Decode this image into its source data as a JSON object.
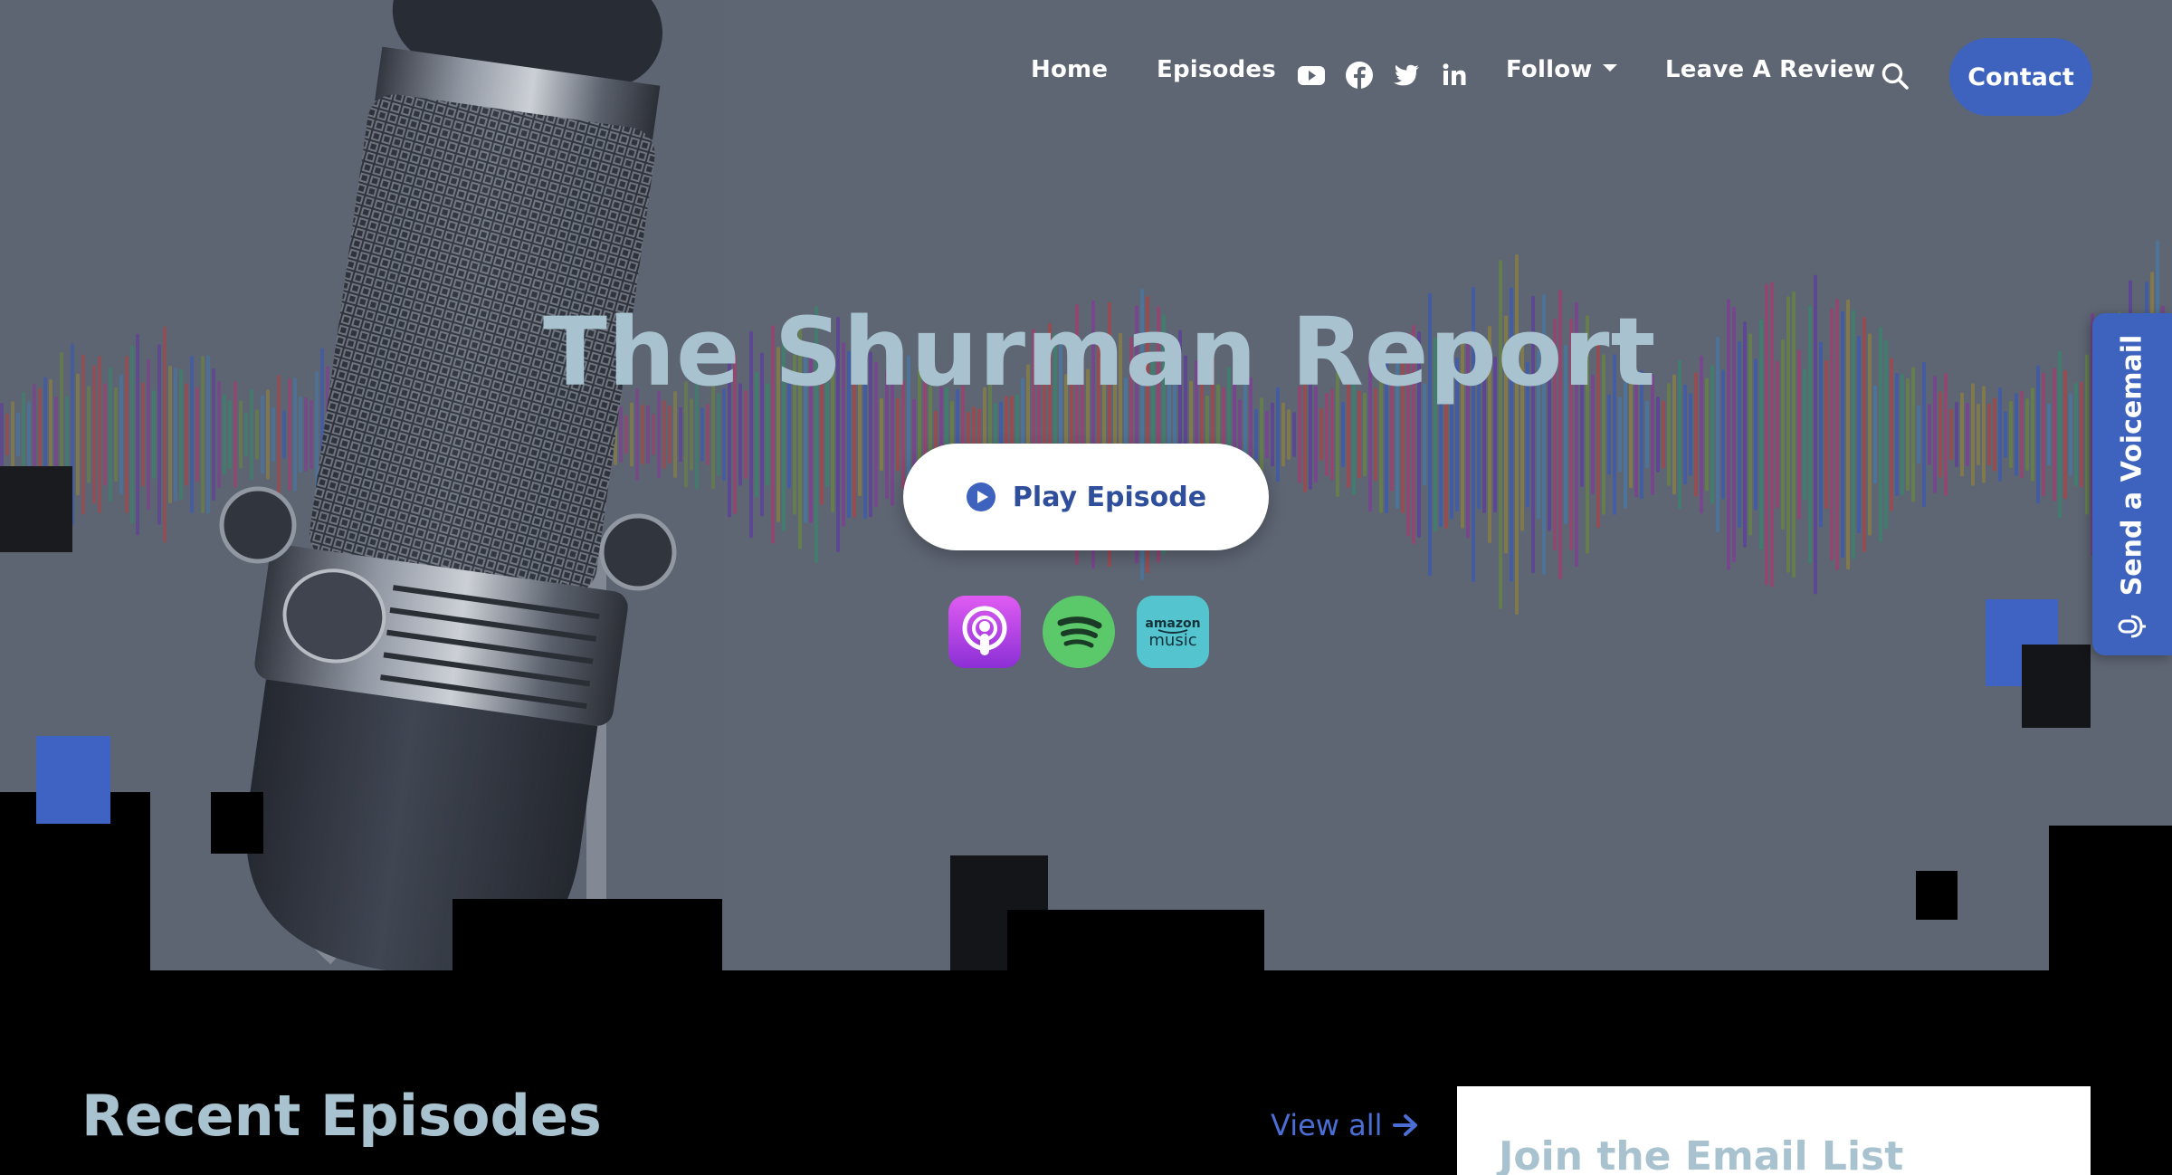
{
  "nav": {
    "items": [
      {
        "label": "Home"
      },
      {
        "label": "Episodes"
      },
      {
        "label": "Follow"
      },
      {
        "label": "Leave A Review"
      }
    ],
    "social": [
      "youtube-icon",
      "facebook-icon",
      "twitter-icon",
      "linkedin-icon"
    ],
    "contact_label": "Contact"
  },
  "hero": {
    "title": "The Shurman Report",
    "play_label": "Play Episode",
    "platforms": [
      "Apple Podcasts",
      "Spotify",
      "Amazon Music"
    ],
    "amazon_logo_line1": "amazon",
    "amazon_logo_line2": "music"
  },
  "voicemail": {
    "label": "Send a Voicemail"
  },
  "recent": {
    "title": "Recent Episodes",
    "view_all": "View all"
  },
  "email": {
    "title": "Join the Email List"
  },
  "colors": {
    "accent": "#3e63bf",
    "title": "#a8c3cf",
    "hero_bg": "#5e6573",
    "link_blue": "#4a6ed4"
  }
}
